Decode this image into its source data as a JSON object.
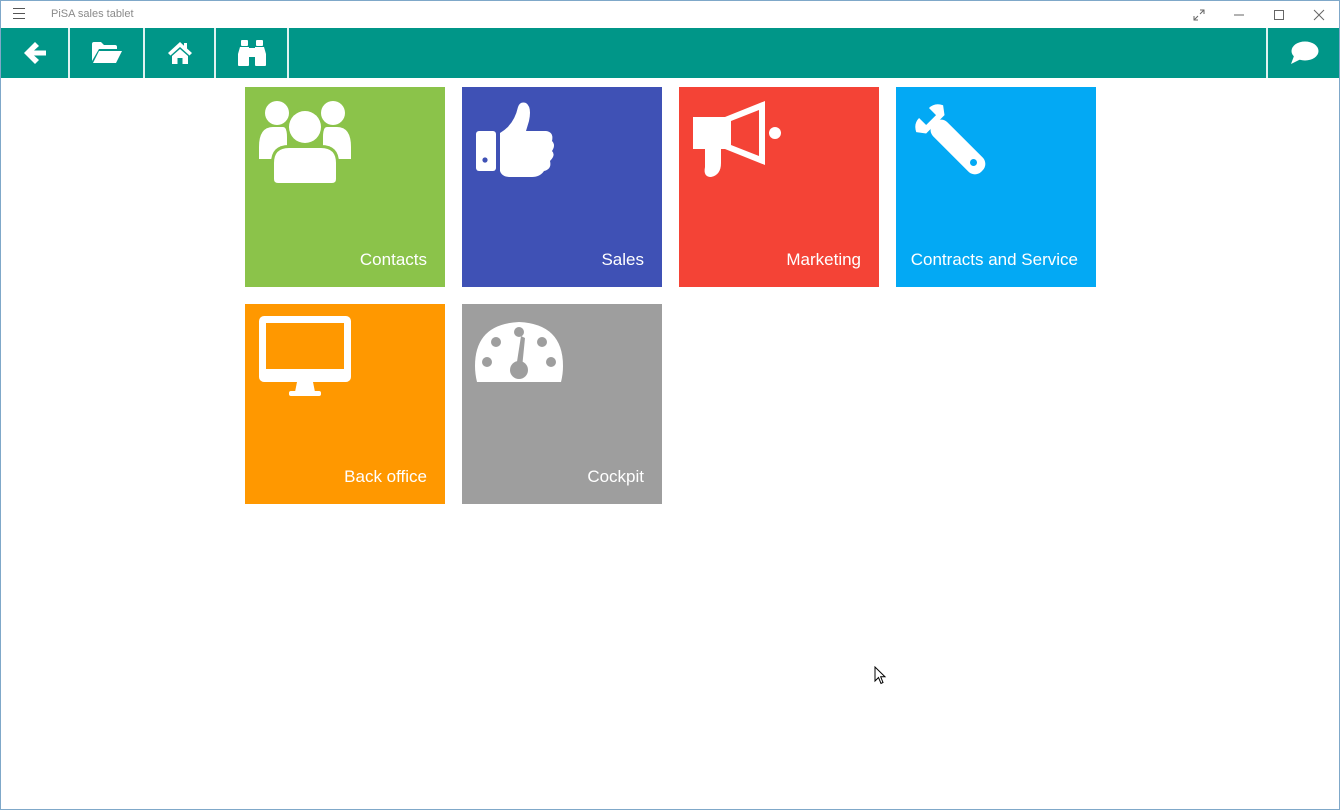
{
  "window": {
    "title": "PiSA sales tablet"
  },
  "tiles": [
    {
      "label": "Contacts",
      "color": "#8BC34A",
      "icon": "people-icon"
    },
    {
      "label": "Sales",
      "color": "#3F51B5",
      "icon": "thumbs-up-icon"
    },
    {
      "label": "Marketing",
      "color": "#F44336",
      "icon": "megaphone-icon"
    },
    {
      "label": "Contracts and Service",
      "color": "#03A9F4",
      "icon": "wrench-icon"
    },
    {
      "label": "Back office",
      "color": "#FF9800",
      "icon": "monitor-icon"
    },
    {
      "label": "Cockpit",
      "color": "#9E9E9E",
      "icon": "speedometer-icon"
    }
  ],
  "toolbar": {
    "color": "#009688",
    "buttons": [
      "back-arrow-icon",
      "folder-open-icon",
      "home-icon",
      "binoculars-icon",
      "chat-icon"
    ]
  }
}
